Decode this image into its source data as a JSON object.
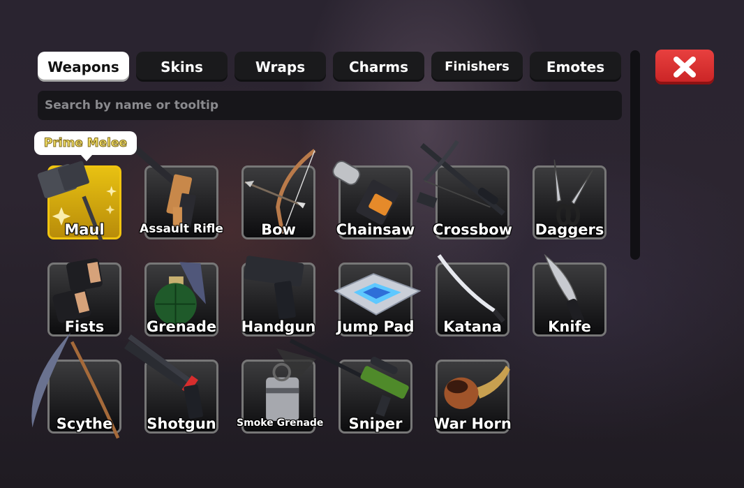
{
  "tabs": [
    {
      "label": "Weapons",
      "active": true
    },
    {
      "label": "Skins",
      "active": false
    },
    {
      "label": "Wraps",
      "active": false
    },
    {
      "label": "Charms",
      "active": false
    },
    {
      "label": "Finishers",
      "active": false
    },
    {
      "label": "Emotes",
      "active": false
    }
  ],
  "search": {
    "placeholder": "Search by name or tooltip"
  },
  "tooltip": {
    "text": "Prime Melee"
  },
  "close": {
    "icon": "close-x-icon",
    "color": "#d8302f"
  },
  "items": [
    {
      "name": "Maul",
      "selected": true
    },
    {
      "name": "Assault Rifle"
    },
    {
      "name": "Bow"
    },
    {
      "name": "Chainsaw"
    },
    {
      "name": "Crossbow"
    },
    {
      "name": "Daggers"
    },
    {
      "name": "Fists"
    },
    {
      "name": "Grenade"
    },
    {
      "name": "Handgun"
    },
    {
      "name": "Jump Pad"
    },
    {
      "name": "Katana"
    },
    {
      "name": "Knife"
    },
    {
      "name": "Scythe"
    },
    {
      "name": "Shotgun"
    },
    {
      "name": "Smoke Grenade"
    },
    {
      "name": "Sniper"
    },
    {
      "name": "War Horn"
    }
  ]
}
